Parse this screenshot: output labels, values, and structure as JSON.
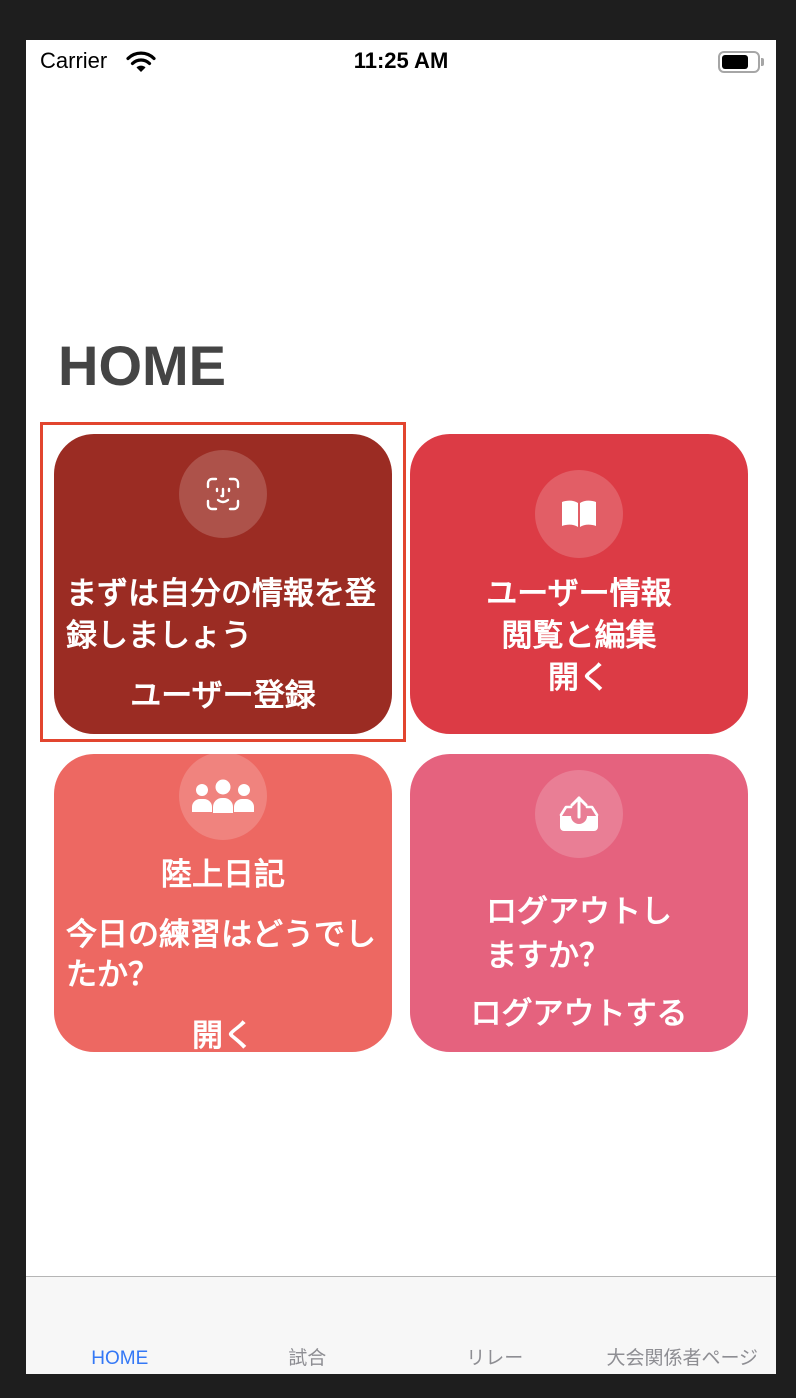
{
  "status_bar": {
    "carrier": "Carrier",
    "time": "11:25 AM",
    "battery_level": 0.75,
    "icons": {
      "wifi": "wifi-icon",
      "battery": "battery-icon"
    }
  },
  "page_title": "HOME",
  "colors": {
    "frame": "#1e1e1e",
    "title": "#444444",
    "highlight": "#e2452f",
    "tab_active": "#3478f6",
    "tab_inactive": "#8e8e93",
    "icon_circle": "rgba(255,255,255,0.18)"
  },
  "cards": [
    {
      "icon": "face-id-icon",
      "color": "#9b2c23",
      "message": "まずは自分の情報を登録しましょう",
      "action": "ユーザー登録"
    },
    {
      "icon": "book-icon",
      "color": "#dc3b45",
      "lines": [
        "ユーザー情報",
        "閲覧と編集",
        "開く"
      ]
    },
    {
      "icon": "group-icon",
      "color": "#ed6862",
      "title": "陸上日記",
      "message": "今日の練習はどうでしたか？",
      "action": "開く"
    },
    {
      "icon": "tray-upload-icon",
      "color": "#e5627e",
      "message": "ログアウトしますか？",
      "action": "ログアウトする"
    }
  ],
  "tabs": [
    {
      "label": "HOME",
      "active": true
    },
    {
      "label": "試合",
      "active": false
    },
    {
      "label": "リレー",
      "active": false
    },
    {
      "label": "大会関係者ページ",
      "active": false
    }
  ]
}
